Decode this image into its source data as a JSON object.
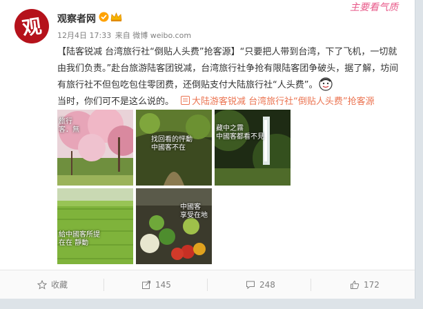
{
  "watermark": "主要看气质",
  "post": {
    "author": "观察者网",
    "avatar_text": "观",
    "date": "12月4日 17:33",
    "source_prefix": "来自",
    "source": "微博 weibo.com",
    "topic_tag": "【陆客锐减 台湾旅行社“倒贴人头费”抢客源】",
    "body_part1": "“只要把人带到台湾，下了飞机，一切就由我们负责。”赴台旅游陆客团锐减，台湾旅行社争抢有限陆客团争破头，据了解，坊间有旅行社不但包吃包住零团费，还倒贴支付大陆旅行社“人头费”。",
    "body_part2": "当时，你们可不是这么说的。",
    "topic_link": "大陆游客锐减 台湾旅行社“倒贴人头费”抢客源"
  },
  "images": [
    {
      "caption": "旅行\n客．無"
    },
    {
      "caption": "找回看的怦動\n中國客不在"
    },
    {
      "caption": "藏中之霧\n中國客都看不見"
    },
    {
      "caption": "給中國客所提\n在在 靜動"
    },
    {
      "caption": "中國客\n享受在地"
    }
  ],
  "actions": {
    "collect": "收藏",
    "repost": "145",
    "comment": "248",
    "like": "172"
  },
  "colors": {
    "accent": "#eb7350",
    "avatar_bg": "#b5121b",
    "verified": "#ffa200"
  }
}
